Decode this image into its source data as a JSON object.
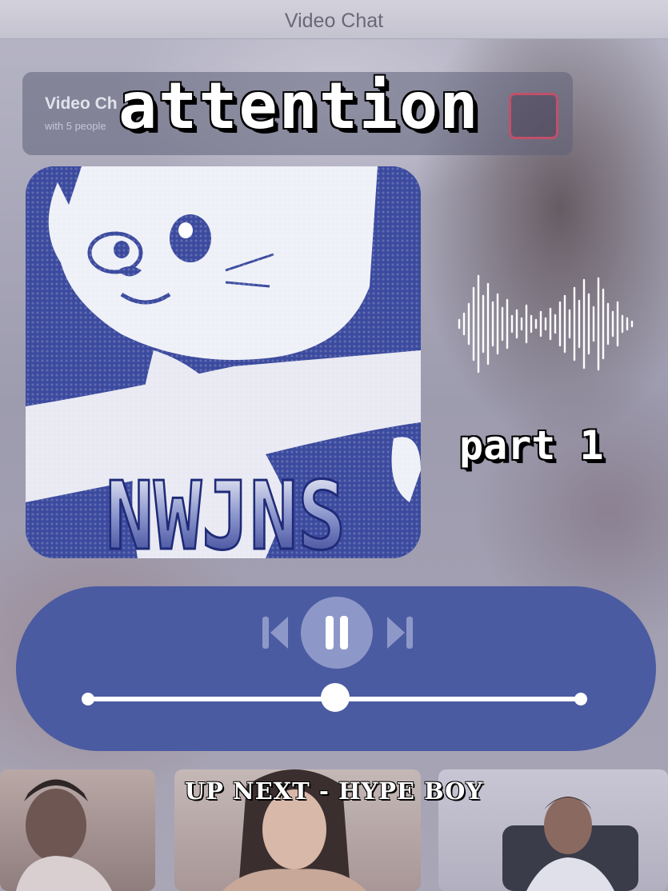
{
  "window": {
    "title": "Video Chat"
  },
  "call_header": {
    "title": "Video Ch",
    "subtitle": "with 5 people"
  },
  "overlay": {
    "song_title": "attention",
    "part_label": "part 1"
  },
  "album": {
    "logo_text": "NWJNS"
  },
  "player": {
    "prev_icon": "skip-previous-icon",
    "play_pause_icon": "pause-icon",
    "next_icon": "skip-next-icon",
    "progress": 0.5
  },
  "up_next": {
    "text": "UP NEXT - HYPE BOY"
  },
  "colors": {
    "player_bg": "#4b5ba2",
    "album_blue": "#3b4a9e",
    "play_button": "#8e98c8"
  }
}
